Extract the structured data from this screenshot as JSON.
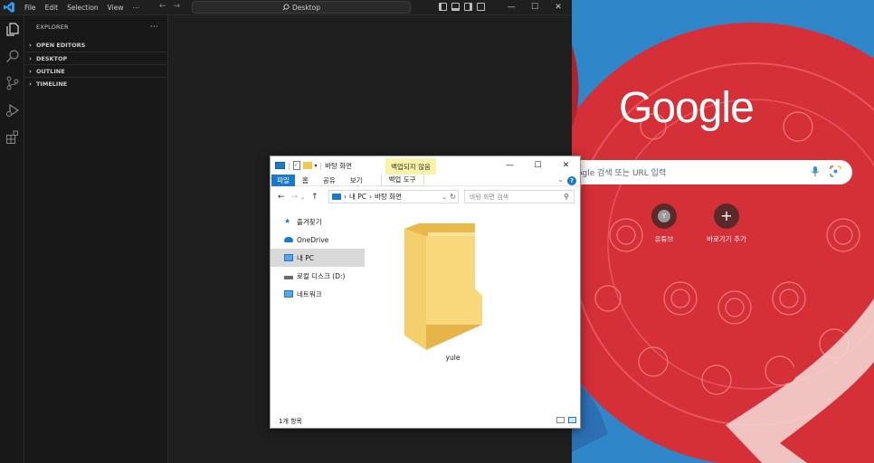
{
  "vscode": {
    "menu": [
      "File",
      "Edit",
      "Selection",
      "View",
      "⋯"
    ],
    "search_text": "Desktop",
    "explorer_title": "EXPLORER",
    "explorer_more": "⋯",
    "sections": [
      "OPEN EDITORS",
      "DESKTOP",
      "OUTLINE",
      "TIMELINE"
    ],
    "accent": "#0078d4"
  },
  "chrome": {
    "logo_text": "Google",
    "search_placeholder": "ogle 검색 또는 URL 입력",
    "shortcuts": [
      {
        "label": "유튜브",
        "glyph": "Y"
      },
      {
        "label": "바로가기 추가",
        "glyph": "+"
      }
    ],
    "bg_red": "#d52f37",
    "bg_blue": "#2f86c9"
  },
  "explorer": {
    "title": "바탕 화면",
    "context_group": "백업되지 않음",
    "tabs": [
      "파일",
      "홈",
      "공유",
      "보기"
    ],
    "context_tab": "백업 도구",
    "address": [
      "내 PC",
      "바탕 화면"
    ],
    "search_placeholder": "바탕 화면 검색",
    "nav": [
      {
        "label": "즐겨찾기",
        "icon": "star-icon"
      },
      {
        "label": "OneDrive",
        "icon": "cloud-icon"
      },
      {
        "label": "내 PC",
        "icon": "monitor-icon"
      },
      {
        "label": "로컬 디스크 (D:)",
        "icon": "drive-icon"
      },
      {
        "label": "네트워크",
        "icon": "network-icon"
      }
    ],
    "selected_nav": 2,
    "folder_name": "yule",
    "status": "1개 항목",
    "win_controls": [
      "—",
      "☐",
      "✕"
    ]
  }
}
